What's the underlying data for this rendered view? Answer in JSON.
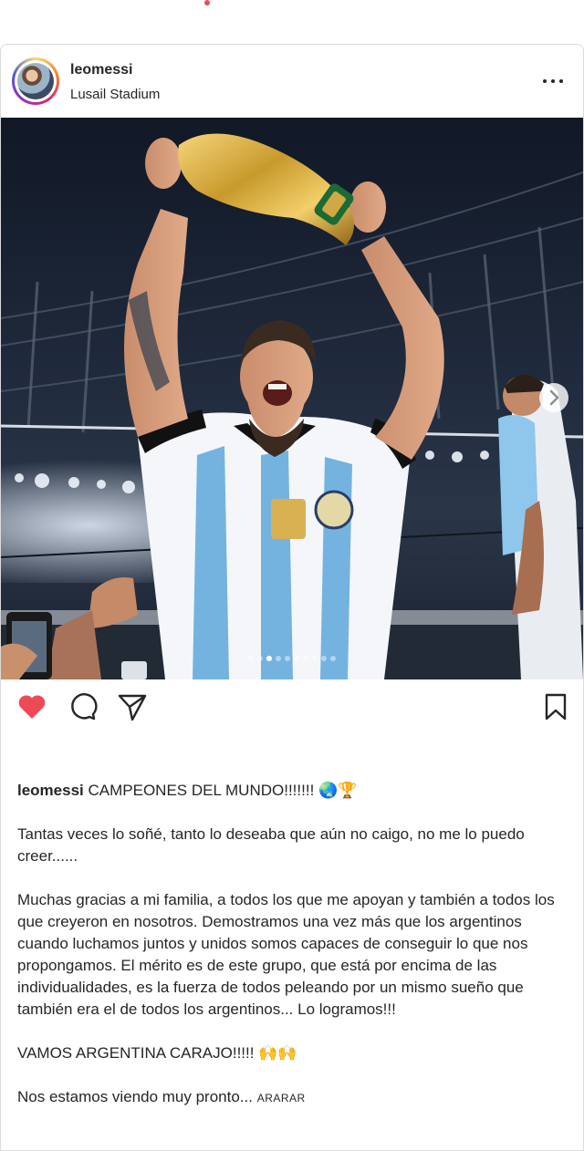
{
  "post": {
    "username": "leomessi",
    "location": "Lusail Stadium",
    "carousel": {
      "slide_count": 10,
      "active_index": 0
    },
    "actions": {
      "like_icon": "heart-filled-icon",
      "comment_icon": "comment-icon",
      "share_icon": "paper-plane-icon",
      "save_icon": "bookmark-icon",
      "liked": true,
      "like_color": "#ed4956"
    },
    "caption": {
      "username": "leomessi",
      "line1": "CAMPEONES DEL MUNDO!!!!!!!",
      "line1_emojis": "🌏🏆",
      "para2": "Tantas veces lo soñé, tanto lo deseaba que aún no caigo, no me lo puedo creer......",
      "para3": "Muchas gracias a mi familia, a todos los que me apoyan y también a todos los que creyeron en nosotros. Demostramos una vez más que los argentinos cuando luchamos juntos y unidos somos capaces de conseguir lo que nos propongamos. El mérito es de este grupo, que está por encima de las individualidades, es la fuerza de todos peleando por un mismo sueño que también era el de todos los argentinos... Lo logramos!!!",
      "para4": "VAMOS ARGENTINA CARAJO!!!!!",
      "para4_emojis": "🙌🙌",
      "para5": "Nos estamos viendo muy pronto...",
      "more_label": "ARARAR"
    }
  },
  "colors": {
    "notification_dot": "#ed4956",
    "text": "#262626",
    "border": "#dbdbdb"
  }
}
